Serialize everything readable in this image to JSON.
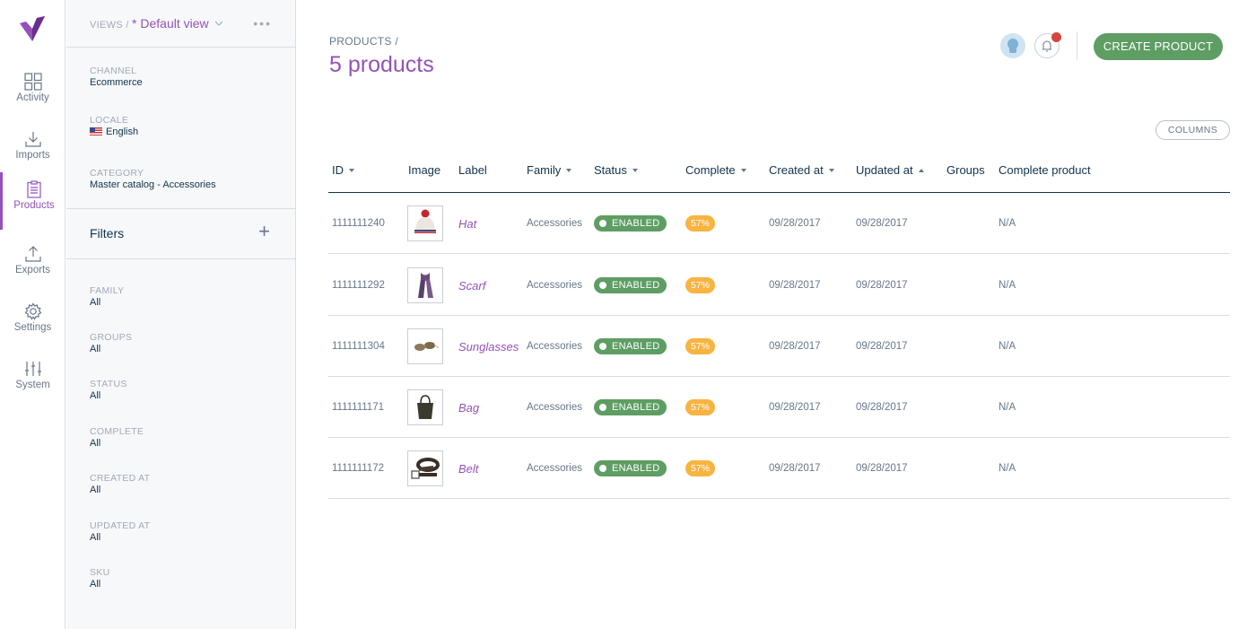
{
  "nav": {
    "items": [
      {
        "label": "Activity",
        "icon": "activity-icon"
      },
      {
        "label": "Imports",
        "icon": "imports-icon"
      },
      {
        "label": "Products",
        "icon": "products-icon"
      },
      {
        "label": "Exports",
        "icon": "exports-icon"
      },
      {
        "label": "Settings",
        "icon": "settings-icon"
      },
      {
        "label": "System",
        "icon": "system-icon"
      }
    ],
    "active": "Products",
    "accent": "#9452ba"
  },
  "sidebar": {
    "views_prefix": "VIEWS /",
    "view_name": "* Default view",
    "context": [
      {
        "key": "CHANNEL",
        "value": "Ecommerce"
      },
      {
        "key": "LOCALE",
        "value": "English"
      },
      {
        "key": "CATEGORY",
        "value": "Master catalog - Accessories"
      }
    ],
    "filters_title": "Filters",
    "filters": [
      {
        "key": "FAMILY",
        "value": "All"
      },
      {
        "key": "GROUPS",
        "value": "All"
      },
      {
        "key": "STATUS",
        "value": "All"
      },
      {
        "key": "COMPLETE",
        "value": "All"
      },
      {
        "key": "CREATED AT",
        "value": "All"
      },
      {
        "key": "UPDATED AT",
        "value": "All"
      },
      {
        "key": "SKU",
        "value": "All"
      }
    ]
  },
  "header": {
    "breadcrumb": "PRODUCTS /",
    "title": "5 products",
    "create_button": "CREATE PRODUCT",
    "columns_button": "COLUMNS"
  },
  "table": {
    "columns": [
      "ID",
      "Image",
      "Label",
      "Family",
      "Status",
      "Complete",
      "Created at",
      "Updated at",
      "Groups",
      "Complete product"
    ],
    "rows": [
      {
        "id": "1111111240",
        "image": "hat",
        "label": "Hat",
        "family": "Accessories",
        "status": "ENABLED",
        "complete": "57%",
        "created": "09/28/2017",
        "updated": "09/28/2017",
        "groups": "",
        "complete_product": "N/A"
      },
      {
        "id": "1111111292",
        "image": "scarf",
        "label": "Scarf",
        "family": "Accessories",
        "status": "ENABLED",
        "complete": "57%",
        "created": "09/28/2017",
        "updated": "09/28/2017",
        "groups": "",
        "complete_product": "N/A"
      },
      {
        "id": "1111111304",
        "image": "sunglasses",
        "label": "Sunglasses",
        "family": "Accessories",
        "status": "ENABLED",
        "complete": "57%",
        "created": "09/28/2017",
        "updated": "09/28/2017",
        "groups": "",
        "complete_product": "N/A"
      },
      {
        "id": "1111111171",
        "image": "bag",
        "label": "Bag",
        "family": "Accessories",
        "status": "ENABLED",
        "complete": "57%",
        "created": "09/28/2017",
        "updated": "09/28/2017",
        "groups": "",
        "complete_product": "N/A"
      },
      {
        "id": "1111111172",
        "image": "belt",
        "label": "Belt",
        "family": "Accessories",
        "status": "ENABLED",
        "complete": "57%",
        "created": "09/28/2017",
        "updated": "09/28/2017",
        "groups": "",
        "complete_product": "N/A"
      }
    ]
  }
}
